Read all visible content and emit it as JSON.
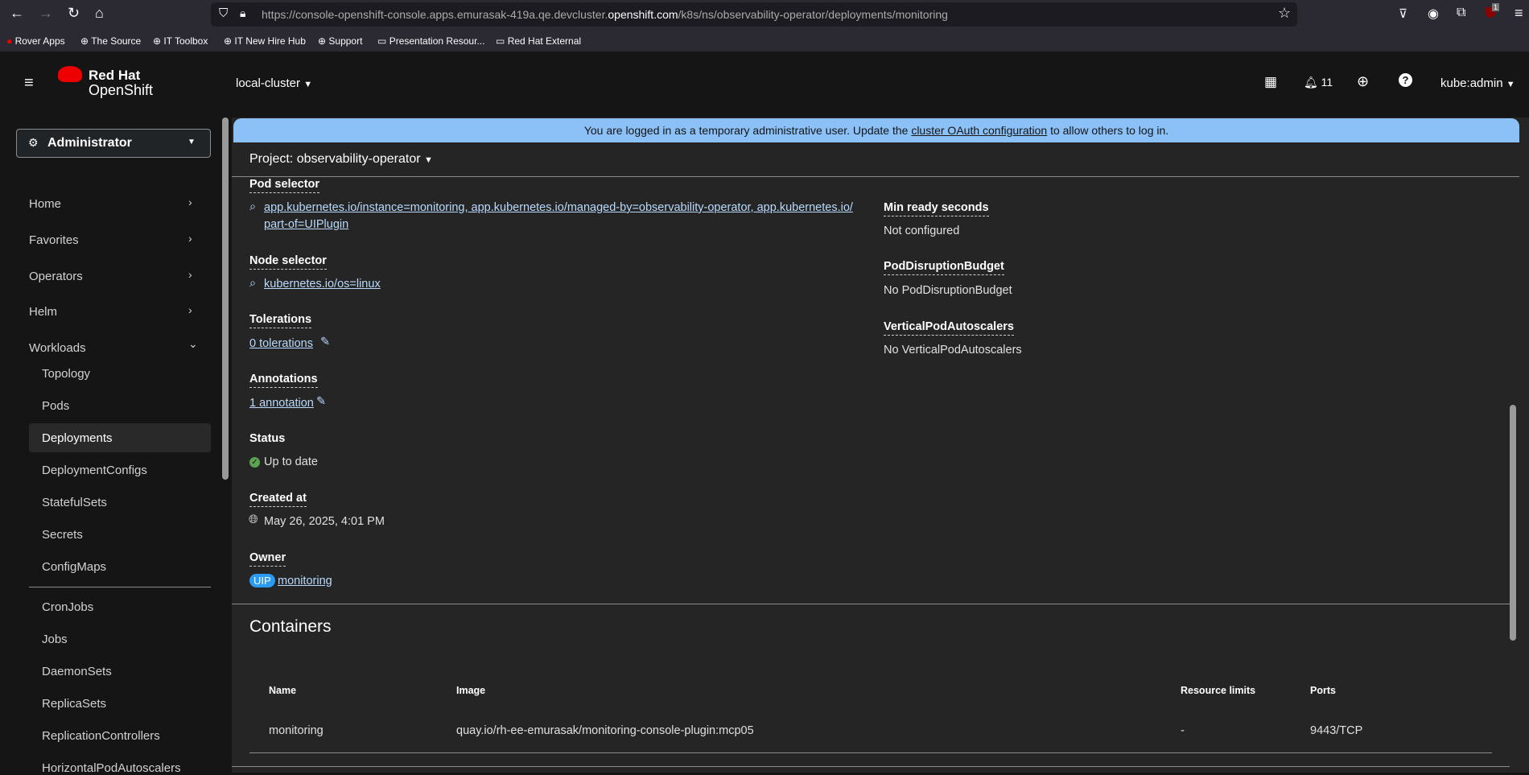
{
  "browser": {
    "url_prefix": "https://console-openshift-console.apps.emurasak-419a.qe.devcluster.",
    "url_domain": "openshift.com",
    "url_path": "/k8s/ns/observability-operator/deployments/monitoring",
    "ext_badge": "1",
    "bookmarks": [
      "Rover Apps",
      "The Source",
      "IT Toolbox",
      "IT New Hire Hub",
      "Support",
      "Presentation Resour...",
      "Red Hat External"
    ]
  },
  "masthead": {
    "brand_line1": "Red Hat",
    "brand_line2": "OpenShift",
    "cluster": "local-cluster",
    "notifications": "11",
    "user": "kube:admin"
  },
  "sidebar": {
    "perspective": "Administrator",
    "items": [
      {
        "label": "Home",
        "chevron": "›"
      },
      {
        "label": "Favorites",
        "chevron": "›"
      },
      {
        "label": "Operators",
        "chevron": "›"
      },
      {
        "label": "Helm",
        "chevron": "›"
      },
      {
        "label": "Workloads",
        "chevron": "⌄"
      }
    ],
    "subitems": [
      "Topology",
      "Pods",
      "Deployments",
      "DeploymentConfigs",
      "StatefulSets",
      "Secrets",
      "ConfigMaps",
      "CronJobs",
      "Jobs",
      "DaemonSets",
      "ReplicaSets",
      "ReplicationControllers",
      "HorizontalPodAutoscalers"
    ],
    "active": "Deployments"
  },
  "banner": {
    "pre": "You are logged in as a temporary administrative user. Update the ",
    "link": "cluster OAuth configuration",
    "post": " to allow others to log in."
  },
  "project": "Project: observability-operator",
  "details": {
    "pod_selector_label": "Pod selector",
    "pod_selector_line1": "app.kubernetes.io/instance=monitoring, app.kubernetes.io/managed-by=observability-operator, app.kubernetes.io/",
    "pod_selector_line2": "part-of=UIPlugin",
    "node_selector_label": "Node selector",
    "node_selector": "kubernetes.io/os=linux",
    "tolerations_label": "Tolerations",
    "tolerations": "0 tolerations",
    "annotations_label": "Annotations",
    "annotations": "1 annotation",
    "status_label": "Status",
    "status": "Up to date",
    "created_label": "Created at",
    "created": "May 26, 2025, 4:01 PM",
    "owner_label": "Owner",
    "owner_badge": "UIP",
    "owner": "monitoring",
    "min_ready_label": "Min ready seconds",
    "min_ready": "Not configured",
    "pdb_label": "PodDisruptionBudget",
    "pdb": "No PodDisruptionBudget",
    "vpa_label": "VerticalPodAutoscalers",
    "vpa": "No VerticalPodAutoscalers"
  },
  "containers": {
    "title": "Containers",
    "headers": [
      "Name",
      "Image",
      "Resource limits",
      "Ports"
    ],
    "rows": [
      [
        "monitoring",
        "quay.io/rh-ee-emurasak/monitoring-console-plugin:mcp05",
        "-",
        "9443/TCP"
      ]
    ]
  }
}
